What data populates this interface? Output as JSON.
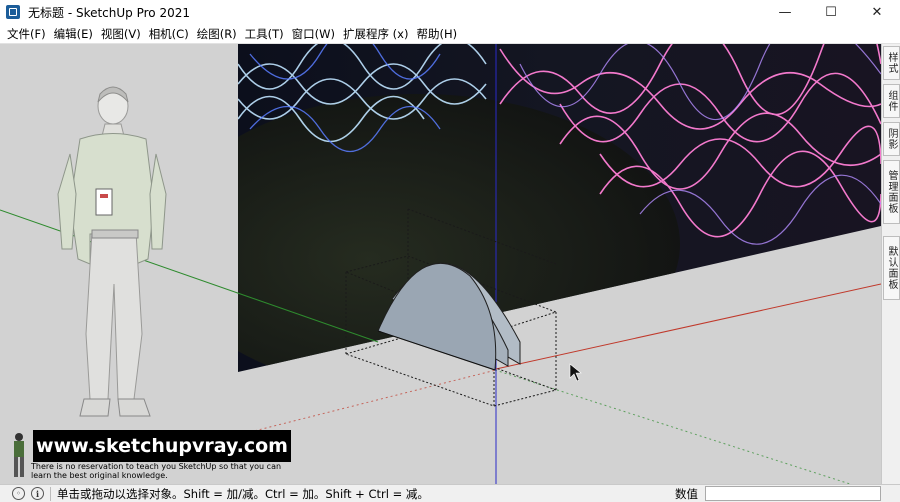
{
  "window": {
    "title": "无标题 - SketchUp Pro 2021",
    "app_icon": "sketchup-icon",
    "controls": {
      "minimize": "—",
      "maximize": "☐",
      "close": "✕"
    }
  },
  "menubar": {
    "items": [
      "文件(F)",
      "编辑(E)",
      "视图(V)",
      "相机(C)",
      "绘图(R)",
      "工具(T)",
      "窗口(W)",
      "扩展程序 (x)",
      "帮助(H)"
    ]
  },
  "right_panel": {
    "tabs": [
      "样式",
      "组件",
      "阴影",
      "管理面板",
      "默认面板"
    ]
  },
  "viewport": {
    "background": "#d2d2d2",
    "axis_colors": {
      "red": "#c0392b",
      "green": "#2e8b2e",
      "blue": "#2a2ac8"
    },
    "profile_color": "#9aa6b3"
  },
  "watermark": {
    "url": "www.sketchupvray.com",
    "caption": "There is no reservation to teach you SketchUp so that you can learn the best original knowledge."
  },
  "statusbar": {
    "hint": "单击或拖动以选择对象。Shift = 加/减。Ctrl = 加。Shift + Ctrl = 减。",
    "value_label": "数值",
    "value": ""
  }
}
